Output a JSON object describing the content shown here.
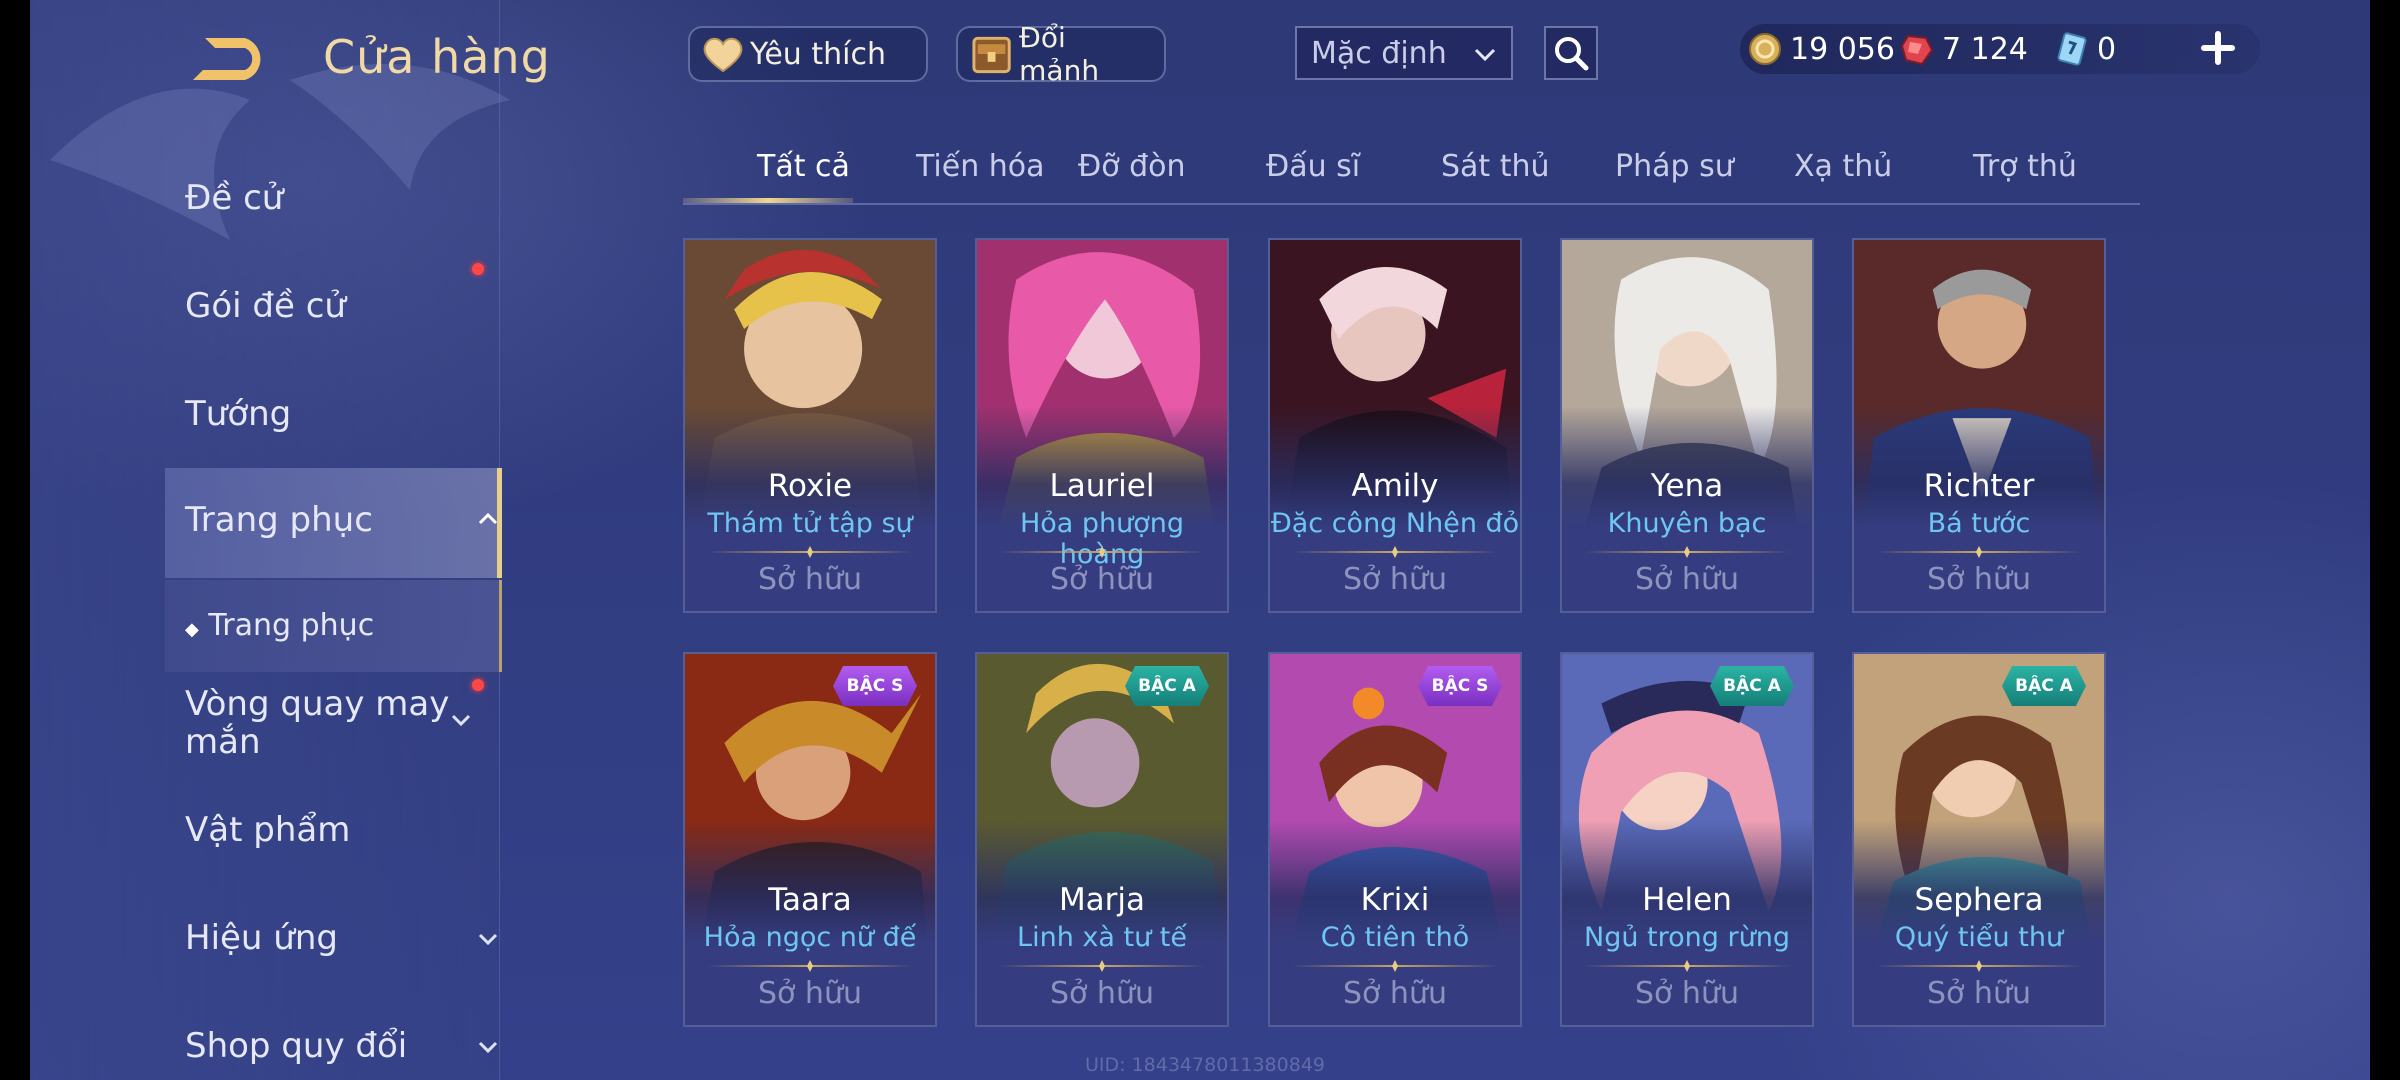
{
  "header": {
    "title": "Cửa hàng",
    "favorite_label": "Yêu thích",
    "exchange_label": "Đổi mảnh",
    "sort_value": "Mặc định",
    "currencies": {
      "gold": "19 056",
      "ruby": "7 124",
      "voucher": "0"
    }
  },
  "sidebar": {
    "items": [
      {
        "label": "Đề cử"
      },
      {
        "label": "Gói đề cử"
      },
      {
        "label": "Tướng"
      },
      {
        "label": "Trang phục"
      },
      {
        "label": "Trang phục"
      },
      {
        "label": "Vòng quay may mắn"
      },
      {
        "label": "Vật phẩm"
      },
      {
        "label": "Hiệu ứng"
      },
      {
        "label": "Shop quy đổi"
      }
    ]
  },
  "tabs": [
    "Tất cả",
    "Tiến hóa",
    "Đỡ đòn",
    "Đấu sĩ",
    "Sát thủ",
    "Pháp sư",
    "Xạ thủ",
    "Trợ thủ"
  ],
  "skins": [
    {
      "hero": "Roxie",
      "skin": "Thám tử tập sự",
      "status": "Sở hữu",
      "badge": ""
    },
    {
      "hero": "Lauriel",
      "skin": "Hỏa phượng hoàng",
      "status": "Sở hữu",
      "badge": ""
    },
    {
      "hero": "Amily",
      "skin": "Đặc công Nhện đỏ",
      "status": "Sở hữu",
      "badge": ""
    },
    {
      "hero": "Yena",
      "skin": "Khuyên bạc",
      "status": "Sở hữu",
      "badge": ""
    },
    {
      "hero": "Richter",
      "skin": "Bá tước",
      "status": "Sở hữu",
      "badge": ""
    },
    {
      "hero": "Taara",
      "skin": "Hỏa ngọc nữ đế",
      "status": "Sở hữu",
      "badge": "BẬC S"
    },
    {
      "hero": "Marja",
      "skin": "Linh xà tư tế",
      "status": "Sở hữu",
      "badge": "BẬC A"
    },
    {
      "hero": "Krixi",
      "skin": "Cô tiên thỏ",
      "status": "Sở hữu",
      "badge": "BẬC S"
    },
    {
      "hero": "Helen",
      "skin": "Ngủ trong rừng",
      "status": "Sở hữu",
      "badge": "BẬC A"
    },
    {
      "hero": "Sephera",
      "skin": "Quý tiểu thư",
      "status": "Sở hữu",
      "badge": "BẬC A"
    }
  ],
  "footer": {
    "uid": "UID: 1843478011380849"
  },
  "colors": {
    "gold": "#f0d9a5",
    "skin_name": "#6ec6f2",
    "badge_s": "#9a45dd",
    "badge_a": "#1f9b8f",
    "notify": "#ff4747"
  },
  "icons": [
    "back-arrow-icon",
    "heart-icon",
    "chest-icon",
    "chevron-down-icon",
    "search-icon",
    "gold-coin-icon",
    "ruby-icon",
    "voucher-icon",
    "plus-icon",
    "chevron-up-icon"
  ]
}
